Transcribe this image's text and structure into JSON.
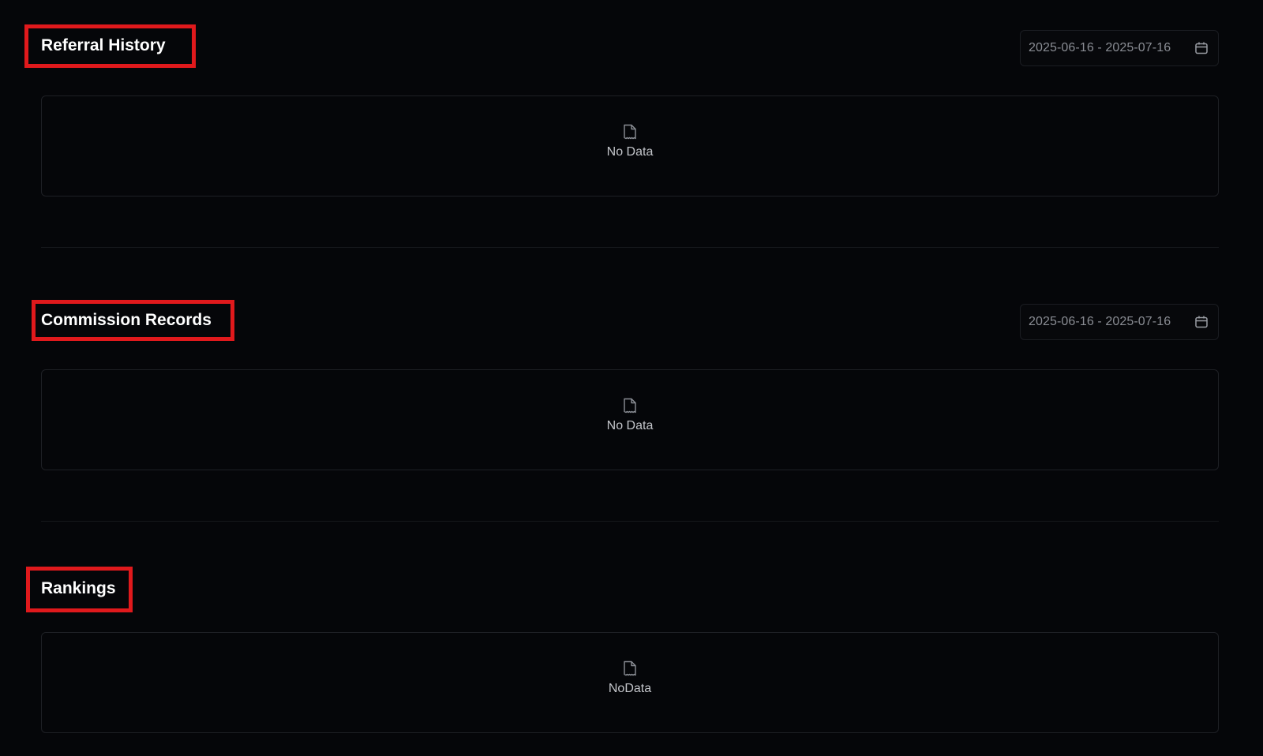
{
  "sections": [
    {
      "title": "Referral History",
      "date_range": "2025-06-16 - 2025-07-16",
      "empty_text": "No Data"
    },
    {
      "title": "Commission Records",
      "date_range": "2025-06-16 - 2025-07-16",
      "empty_text": "No Data"
    },
    {
      "title": "Rankings",
      "empty_text": "NoData"
    }
  ],
  "icons": {
    "calendar": "calendar-icon",
    "empty": "empty-document-icon"
  },
  "colors": {
    "background": "#050609",
    "highlight": "#e0191c",
    "title": "#ffffff",
    "muted_text": "#8a8d94"
  }
}
